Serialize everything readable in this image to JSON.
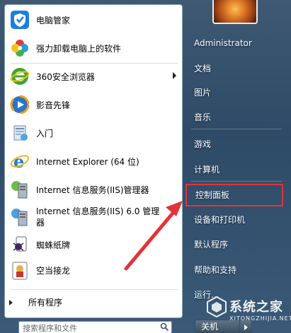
{
  "pinned": [
    {
      "label": "电脑管家",
      "icon": "tencent-shield-icon"
    },
    {
      "label": "强力卸载电脑上的软件",
      "icon": "clover-icon"
    }
  ],
  "recent": [
    {
      "label": "360安全浏览器",
      "icon": "360-browser-icon",
      "has_submenu": true
    },
    {
      "label": "影音先锋",
      "icon": "media-player-icon"
    },
    {
      "label": "入门",
      "icon": "getting-started-icon"
    },
    {
      "label": "Internet Explorer (64 位)",
      "icon": "ie-icon"
    },
    {
      "label": "Internet 信息服务(IIS)管理器",
      "icon": "iis-server-icon"
    },
    {
      "label": "Internet 信息服务(IIS) 6.0 管理器",
      "icon": "iis-server-icon"
    },
    {
      "label": "蜘蛛纸牌",
      "icon": "spider-solitaire-icon"
    },
    {
      "label": "空当接龙",
      "icon": "freecell-icon"
    }
  ],
  "all_programs": "所有程序",
  "search": {
    "placeholder": "搜索程序和文件"
  },
  "right": {
    "user": "Administrator",
    "items": [
      "文档",
      "图片",
      "音乐",
      "游戏",
      "计算机",
      "控制面板",
      "设备和打印机",
      "默认程序",
      "帮助和支持",
      "运行..."
    ],
    "highlighted": "控制面板",
    "shutdown": "关机"
  },
  "watermark": {
    "title": "系统之家",
    "sub": "XITONGZHIJIA.NET"
  },
  "colors": {
    "highlight_box": "#e3333a",
    "annotation_arrow": "#e3333a",
    "menu_right_bg": "#2e4a66"
  }
}
